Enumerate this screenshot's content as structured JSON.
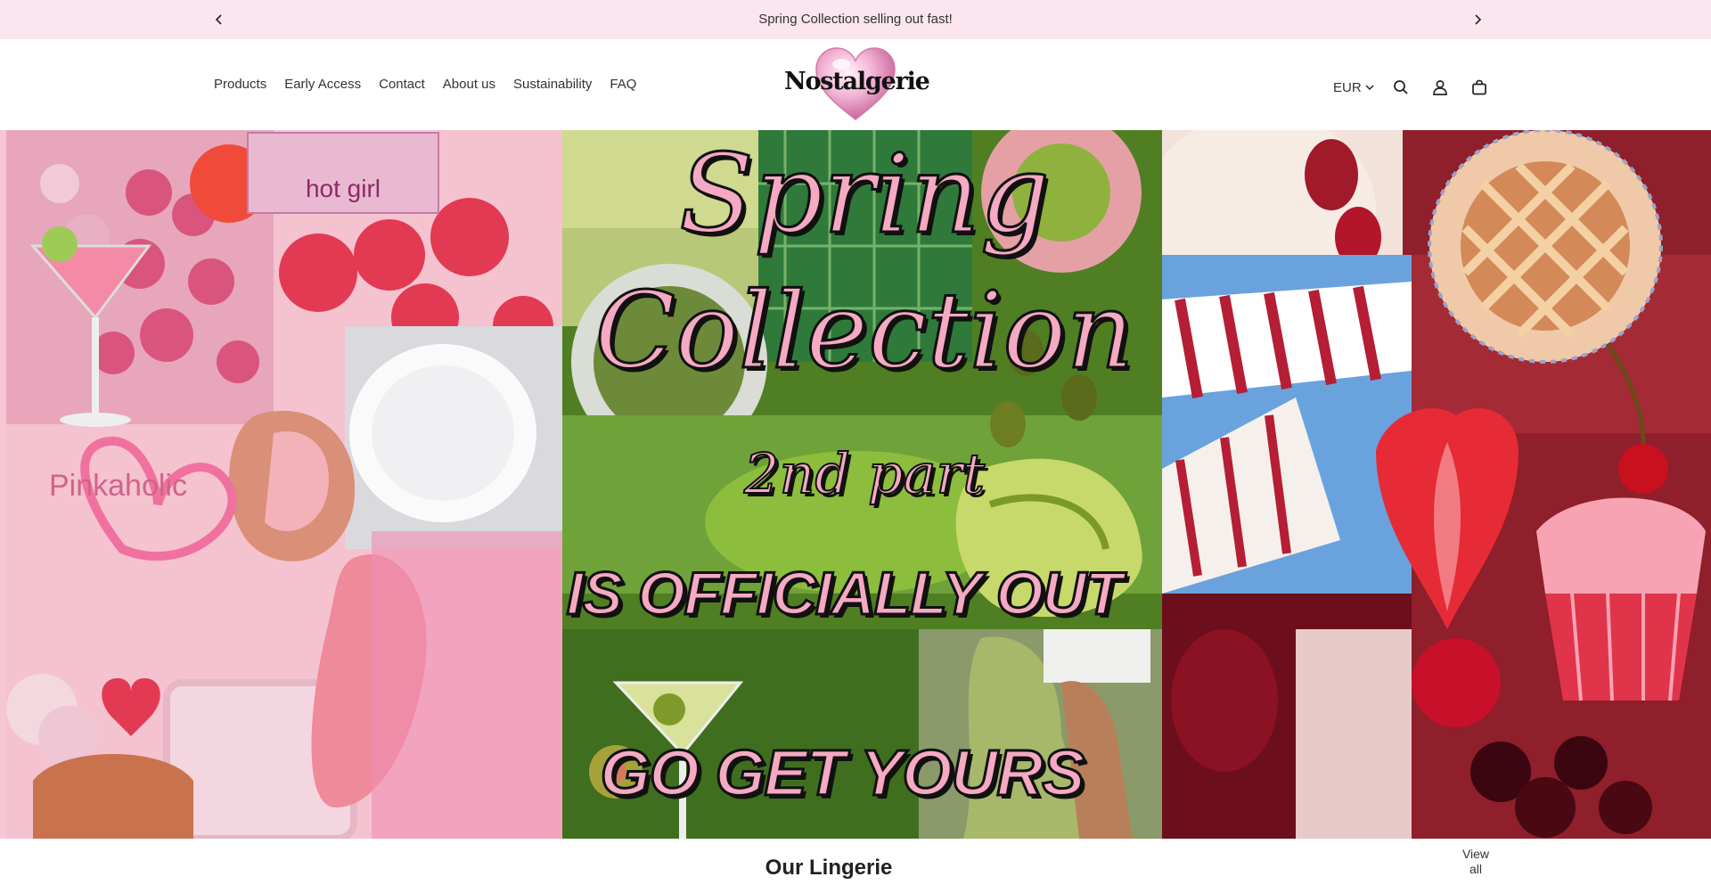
{
  "announcement": {
    "message": "Spring Collection selling out fast!",
    "prev_icon": "chevron-left-icon",
    "next_icon": "chevron-right-icon",
    "background": "#fbe6ef"
  },
  "nav": {
    "items": [
      {
        "label": "Products"
      },
      {
        "label": "Early Access"
      },
      {
        "label": "Contact"
      },
      {
        "label": "About us"
      },
      {
        "label": "Sustainability"
      },
      {
        "label": "FAQ"
      }
    ]
  },
  "brand": {
    "name": "Nostalgerie",
    "logo_icon": "pink-heart-icon"
  },
  "utilities": {
    "currency": "EUR",
    "icons": [
      "search-icon",
      "account-icon",
      "cart-bag-icon"
    ]
  },
  "hero": {
    "line1": "Spring",
    "line2": "Collection",
    "line3": "2nd part",
    "line4": "IS OFFICIALLY OUT",
    "line5": "GO GET YOURS",
    "left_badge_text": "hot girl",
    "left_caption": "Pinkaholic",
    "colors": {
      "pink": "#f6a9c2",
      "green": "#5f8a2a",
      "red": "#8e1f2b"
    }
  },
  "section": {
    "title": "Our Lingerie",
    "view_all": "View all"
  }
}
